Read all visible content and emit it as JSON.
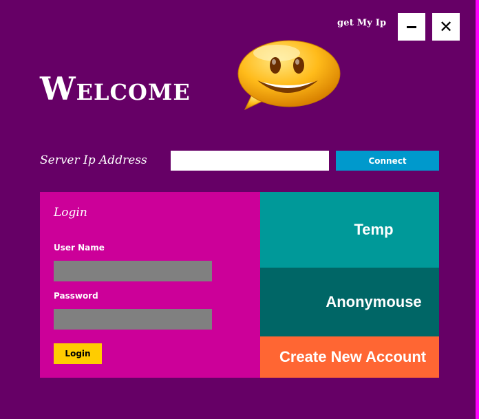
{
  "titlebar": {
    "get_ip_label": "get My Ip",
    "minimize_icon": "minimize-icon",
    "close_icon": "close-icon"
  },
  "header": {
    "welcome": "Welcome",
    "mascot_icon": "smiley-chat-bubble-icon"
  },
  "server": {
    "label": "Server Ip Address",
    "ip_value": "",
    "connect_label": "Connect"
  },
  "login": {
    "title": "Login",
    "username_label": "User Name",
    "username_value": "",
    "password_label": "Password",
    "password_value": "",
    "login_button": "Login"
  },
  "tiles": {
    "temp": "Temp",
    "anonymous": "Anonymouse",
    "create_account": "Create New Account"
  },
  "colors": {
    "background": "#660066",
    "login_panel": "#cc0099",
    "connect": "#0099cc",
    "temp": "#009999",
    "anonymous": "#006666",
    "create": "#ff6633",
    "login_button": "#ffcc00",
    "field": "#808080"
  }
}
